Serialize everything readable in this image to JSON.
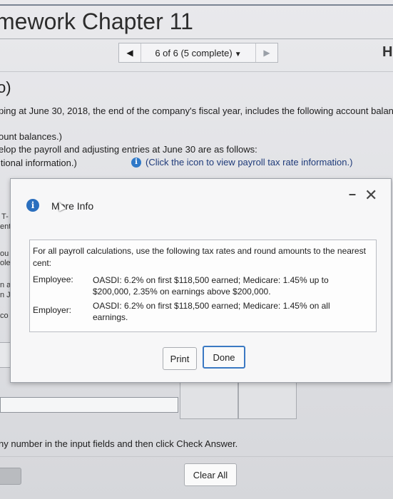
{
  "page": {
    "title": "mework Chapter 11",
    "pager": {
      "label": "6 of 6 (5 complete)"
    },
    "help_fragment": "H",
    "section_heading": "o)",
    "line1": "ping at June 30, 2018, the end of the company's fiscal year, includes the following account balan",
    "line2": "ount balances.)",
    "line3": "elop the payroll and adjusting entries at June 30 are as follows:",
    "line4": "itional information.)",
    "info_link": "(Click the icon to view payroll tax rate information.)",
    "fragments": [
      "T-",
      "ent",
      "ou",
      "ole.",
      "n a",
      "n J",
      "co"
    ],
    "instruction": "ny number in the input fields and then click Check Answer.",
    "clear_all": "Clear All"
  },
  "modal": {
    "title": "More Info",
    "intro": "For all payroll calculations, use the following tax rates and round amounts to the nearest cent:",
    "rows": [
      {
        "label": "Employee:",
        "text": "OASDI: 6.2% on first $118,500 earned; Medicare: 1.45% up to $200,000, 2.35% on earnings above $200,000."
      },
      {
        "label": "Employer:",
        "text": "OASDI: 6.2% on first $118,500 earned; Medicare: 1.45% on all earnings."
      }
    ],
    "print_label": "Print",
    "done_label": "Done"
  }
}
